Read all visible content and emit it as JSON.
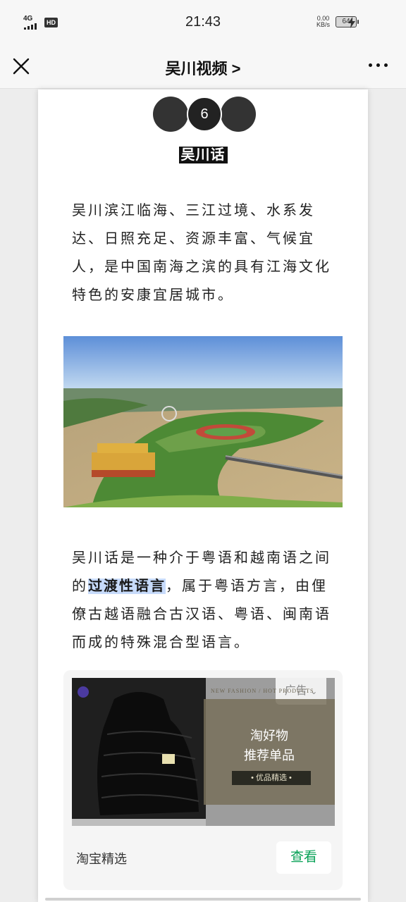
{
  "status_bar": {
    "network": "4G",
    "hd": "HD",
    "time": "21:43",
    "speed_value": "0.00",
    "speed_unit": "KB/s",
    "battery": "64"
  },
  "nav": {
    "title": "吴川视频 >"
  },
  "section": {
    "number": "6",
    "title": "吴川话"
  },
  "article": {
    "para1": "吴川滨江临海、三江过境、水系发达、日照充足、资源丰富、气候宜人，是中国南海之滨的具有江海文化特色的安康宜居城市。",
    "para2_before": "吴川话是一种介于粤语和越南语之间的",
    "para2_highlight": "过渡性语言",
    "para2_after": "，属于粤语方言，由俚僚古越语融合古汉语、粤语、闽南语而成的特殊混合型语言。"
  },
  "ad": {
    "label": "广告",
    "tagline": "NEW FASHION / HOT PRODUCTS",
    "line1": "淘好物",
    "line2": "推荐单品",
    "badge": "•  优品精选  •",
    "source": "淘宝精选",
    "view_button": "查看"
  },
  "colors": {
    "highlight": "#c7dbfb",
    "view_button_text": "#07a156"
  }
}
